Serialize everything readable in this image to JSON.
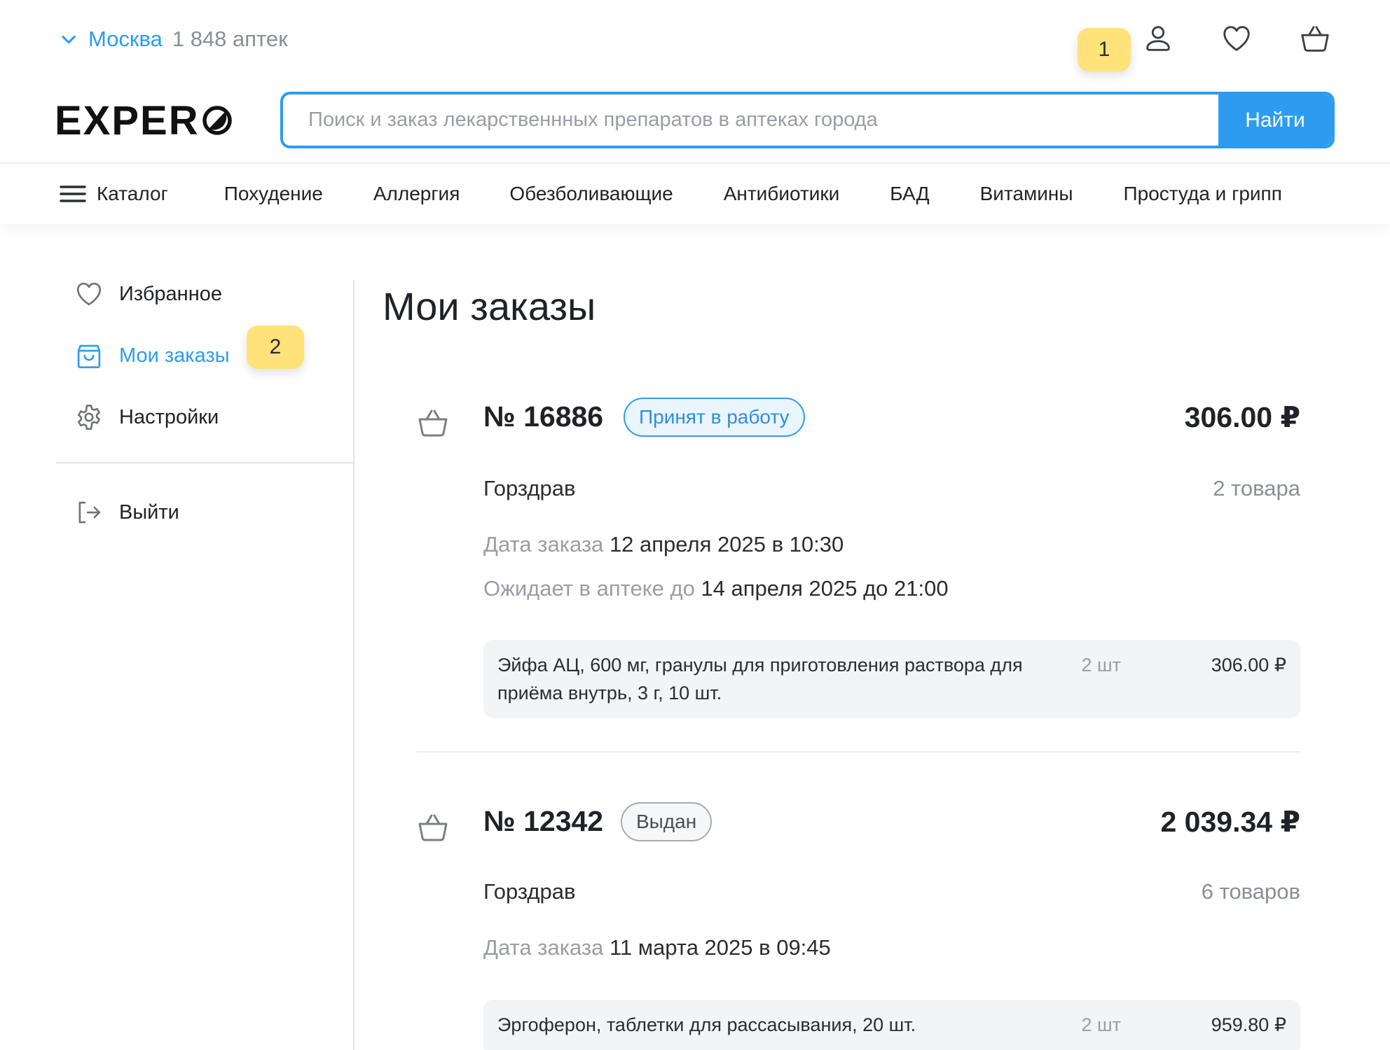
{
  "header": {
    "city": "Москва",
    "pharmacy_count": "1 848 аптек",
    "annotation_1": "1",
    "annotation_2": "2",
    "logo_text": "EXPER",
    "search_placeholder": "Поиск и заказ лекарственнных препаратов в аптеках города",
    "search_button": "Найти",
    "icons": [
      "user-icon",
      "heart-icon",
      "basket-icon"
    ]
  },
  "nav": {
    "catalog": "Каталог",
    "items": [
      "Похудение",
      "Аллергия",
      "Обезболивающие",
      "Антибиотики",
      "БАД",
      "Витамины",
      "Простуда и грипп"
    ]
  },
  "sidebar": {
    "items": [
      {
        "label": "Избранное",
        "icon": "heart-icon"
      },
      {
        "label": "Мои заказы",
        "icon": "bag-icon",
        "active": true
      },
      {
        "label": "Настройки",
        "icon": "gear-icon"
      }
    ],
    "logout": "Выйти"
  },
  "main": {
    "title": "Мои заказы",
    "orders": [
      {
        "number": "№ 16886",
        "status": "Принят в работу",
        "total": "306.00 ₽",
        "pharmacy": "Горздрав",
        "count": "2 товара",
        "date_label": "Дата заказа",
        "date_value": "12 апреля 2025 в 10:30",
        "wait_label": "Ожидает в аптеке до",
        "wait_value": "14 апреля 2025 до 21:00",
        "items": [
          {
            "name": "Эйфа АЦ, 600 мг, гранулы для приготовления раствора для приёма внутрь, 3 г, 10 шт.",
            "qty": "2 шт",
            "price": "306.00 ₽"
          }
        ]
      },
      {
        "number": "№ 12342",
        "status": "Выдан",
        "total": "2 039.34 ₽",
        "pharmacy": "Горздрав",
        "count": "6 товаров",
        "date_label": "Дата заказа",
        "date_value": "11 марта 2025 в 09:45",
        "items": [
          {
            "name": "Эргоферон, таблетки для рассасывания, 20 шт.",
            "qty": "2 шт",
            "price": "959.80 ₽"
          }
        ]
      }
    ]
  },
  "colors": {
    "accent": "#2d9cf0",
    "annotation": "#ffe27a",
    "item_bg": "#f3f4f6"
  }
}
